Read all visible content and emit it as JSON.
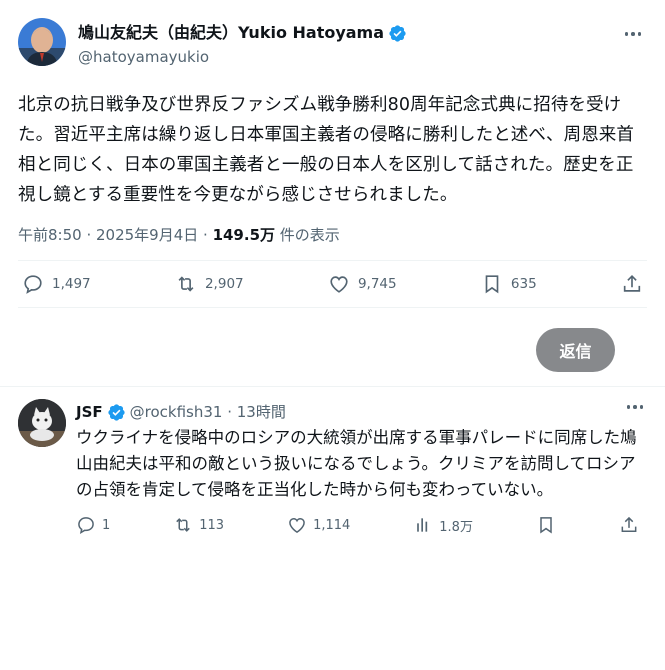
{
  "post": {
    "display_name": "鳩山友紀夫（由紀夫）Yukio Hatoyama",
    "handle": "@hatoyamayukio",
    "text": "北京の抗日戦争及び世界反ファシズム戦争勝利80周年記念式典に招待を受けた。習近平主席は繰り返し日本軍国主義者の侵略に勝利したと述べ、周恩来首相と同じく、日本の軍国主義者と一般の日本人を区別して話された。歴史を正視し鏡とする重要性を今更ながら感じさせられました。",
    "time": "午前8:50 · 2025年9月4日 · ",
    "views_count": "149.5万",
    "views_suffix": " 件の表示",
    "replies": "1,497",
    "reposts": "2,907",
    "likes": "9,745",
    "bookmarks": "635"
  },
  "reply_button": {
    "label": "返信"
  },
  "reply": {
    "name": "JSF",
    "handle": "@rockfish31 · 13時間",
    "text": "ウクライナを侵略中のロシアの大統領が出席する軍事パレードに同席した鳩山由紀夫は平和の敵という扱いになるでしょう。クリミアを訪問してロシアの占領を肯定して侵略を正当化した時から何も変わっていない。",
    "replies": "1",
    "reposts": "113",
    "likes": "1,114",
    "views": "1.8万"
  },
  "colors": {
    "verified": "#1d9bf0",
    "muted": "#536471",
    "reply_button": "#87898c"
  },
  "icons": [
    "verified-icon",
    "more-icon",
    "reply-icon",
    "repost-icon",
    "like-icon",
    "bookmark-icon",
    "share-icon",
    "views-icon"
  ]
}
